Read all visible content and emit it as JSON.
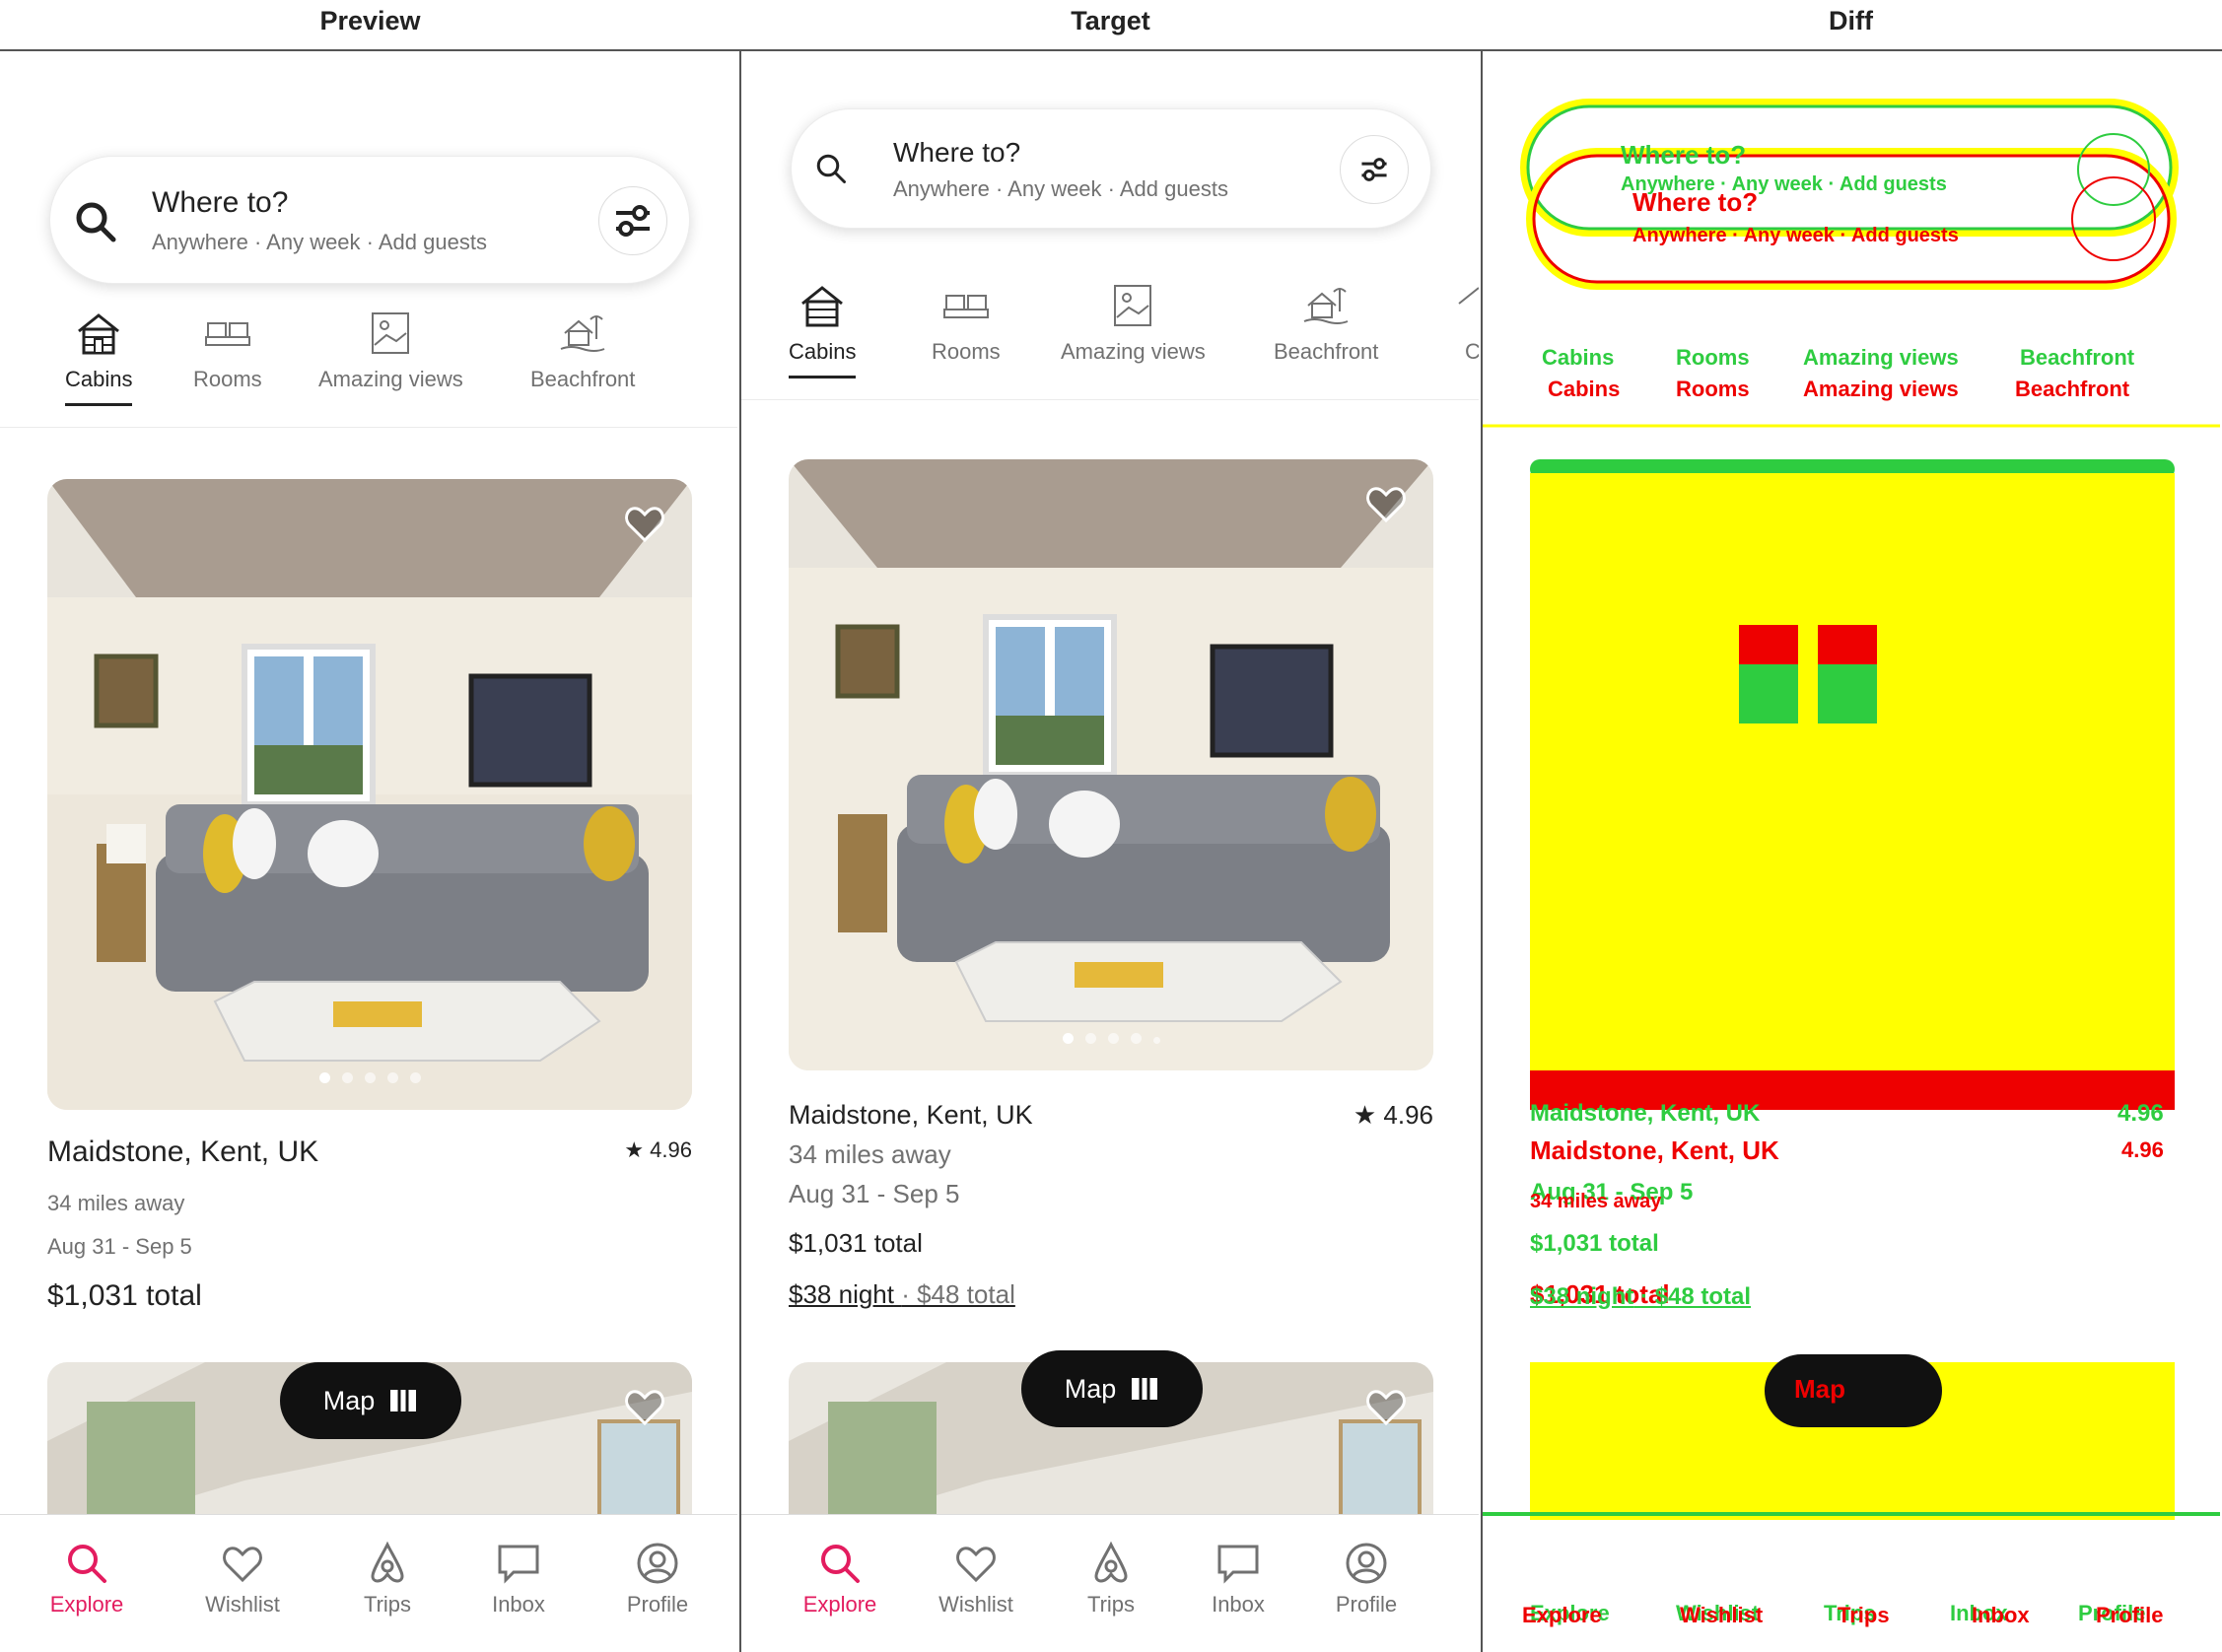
{
  "panels": {
    "preview_label": "Preview",
    "target_label": "Target",
    "diff_label": "Diff"
  },
  "search": {
    "title": "Where to?",
    "subtitle": "Anywhere · Any week · Add guests"
  },
  "categories": [
    {
      "label": "Cabins",
      "icon": "cabin-icon",
      "active": true
    },
    {
      "label": "Rooms",
      "icon": "bed-icon",
      "active": false
    },
    {
      "label": "Amazing views",
      "icon": "picture-icon",
      "active": false
    },
    {
      "label": "Beachfront",
      "icon": "beach-icon",
      "active": false
    },
    {
      "label": "Ca",
      "icon": "cabin-icon",
      "active": false
    }
  ],
  "listing": {
    "location": "Maidstone, Kent, UK",
    "rating": "4.96",
    "distance": "34 miles away",
    "dates": "Aug 31 - Sep 5",
    "total": "$1,031 total",
    "night_price": "$38 night",
    "night_total": "· $48 total",
    "photo_count": 5,
    "active_photo": 1
  },
  "map_button": {
    "label": "Map"
  },
  "nav": [
    {
      "label": "Explore",
      "icon": "search-icon",
      "active": true
    },
    {
      "label": "Wishlist",
      "icon": "heart-icon",
      "active": false
    },
    {
      "label": "Trips",
      "icon": "airbnb-icon",
      "active": false
    },
    {
      "label": "Inbox",
      "icon": "message-icon",
      "active": false
    },
    {
      "label": "Profile",
      "icon": "profile-icon",
      "active": false
    }
  ],
  "colors": {
    "accent": "#e31c5f",
    "text": "#222222",
    "muted": "#717171",
    "diff_highlight": "#ffff00"
  }
}
